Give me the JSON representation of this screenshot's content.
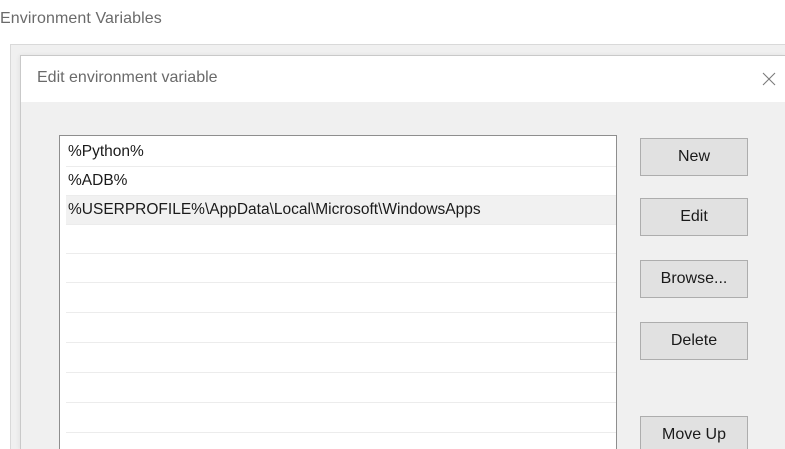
{
  "background_window": {
    "title": "Environment Variables"
  },
  "dialog": {
    "title": "Edit environment variable",
    "close_icon": "close-icon"
  },
  "list": {
    "items": [
      {
        "value": "%Python%",
        "selected": false
      },
      {
        "value": "%ADB%",
        "selected": false
      },
      {
        "value": "%USERPROFILE%\\AppData\\Local\\Microsoft\\WindowsApps",
        "selected": true
      },
      {
        "value": "",
        "selected": false
      },
      {
        "value": "",
        "selected": false
      },
      {
        "value": "",
        "selected": false
      },
      {
        "value": "",
        "selected": false
      },
      {
        "value": "",
        "selected": false
      },
      {
        "value": "",
        "selected": false
      },
      {
        "value": "",
        "selected": false
      },
      {
        "value": "",
        "selected": false
      }
    ]
  },
  "buttons": {
    "new_label": "New",
    "edit_label": "Edit",
    "browse_label": "Browse...",
    "delete_label": "Delete",
    "move_up_label": "Move Up"
  },
  "colors": {
    "dialog_bg": "#f0f0f0",
    "titlebar_bg": "#ffffff",
    "button_bg": "#e1e1e1",
    "button_border": "#adadad",
    "selection_bg": "#f1f1f1"
  }
}
